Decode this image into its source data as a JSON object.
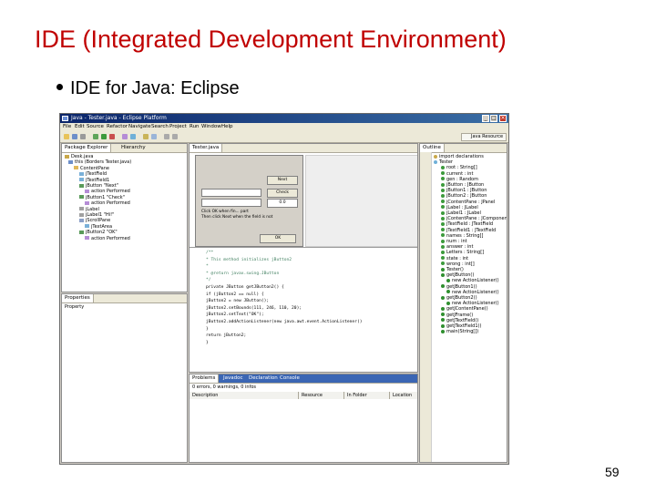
{
  "slide": {
    "title": "IDE (Integrated Development Environment)",
    "bullet": "IDE for Java: Eclipse",
    "page_number": "59"
  },
  "window": {
    "title": "Java - Tester.java - Eclipse Platform",
    "controls": [
      "_",
      "□",
      "×"
    ]
  },
  "menu": [
    "File",
    "Edit",
    "Source",
    "Refactor",
    "Navigate",
    "Search",
    "Project",
    "Run",
    "Window",
    "Help"
  ],
  "perspective": {
    "label": "Java",
    "other": "Resource"
  },
  "package_explorer": {
    "tabs": [
      "Package Explorer",
      "Hierarchy"
    ],
    "rows": [
      "Desk.java",
      "this (Borders Tester.java)",
      "ContentPane",
      "jTextField",
      "jTextField1",
      "jButton \"Next\"",
      "action Performed",
      "jButton1 \"Check\"",
      "action Performed",
      "jLabel",
      "jLabel1 \"Hi!\"",
      "jScrollPane",
      "jTextArea",
      "jButton2 \"OK\"",
      "action Performed"
    ]
  },
  "properties": {
    "tab": "Properties",
    "row": "Property"
  },
  "editor": {
    "tab": "Tester.java",
    "preview": {
      "btn1": "Next",
      "btn2": "Check",
      "field_value": "0.0",
      "text_line1": "Click OK when fin... part",
      "text_line2": "Then click Next when the field is not",
      "ok": "OK"
    },
    "code": [
      {
        "cls": "c-comment",
        "text": "/**"
      },
      {
        "cls": "c-comment",
        "text": " * This method initializes jButton2"
      },
      {
        "cls": "c-comment",
        "text": " *"
      },
      {
        "cls": "c-comment",
        "text": " * @return javax.swing.JButton"
      },
      {
        "cls": "c-comment",
        "text": " */"
      },
      {
        "cls": "",
        "text": "private JButton getJButton2() {"
      },
      {
        "cls": "",
        "text": "    if (jButton2 == null) {"
      },
      {
        "cls": "",
        "text": "        jButton2 = new JButton();"
      },
      {
        "cls": "",
        "text": "        jButton2.setBounds(111, 246, 110, 20);"
      },
      {
        "cls": "",
        "text": "        jButton2.setText(\"OK\");"
      },
      {
        "cls": "",
        "text": "        jButton2.addActionListener(new java.awt.event.ActionListener()"
      },
      {
        "cls": "",
        "text": "    }"
      },
      {
        "cls": "",
        "text": "    return jButton2;"
      },
      {
        "cls": "",
        "text": "}"
      }
    ]
  },
  "outline": {
    "tab": "Outline",
    "rows": [
      "import declarations",
      "Tester",
      "root : String[]",
      "current : int",
      "gen : Random",
      "jButton : JButton",
      "jButton1 : JButton",
      "jButton2 : JButton",
      "jContentPane : JPanel",
      "jLabel : JLabel",
      "jLabel1 : JLabel",
      "jContentPane : JComponent",
      "jTextField : JTextField",
      "jTextField1 : JTextField",
      "names : String[]",
      "num : int",
      "answer : int",
      "Letters : String[]",
      "state : int",
      "wrong : int[]",
      "Tester()",
      "getJButton()",
      "new ActionListener()",
      "getJButton1()",
      "new ActionListener()",
      "getJButton2()",
      "new ActionListener()",
      "getJContentPane()",
      "getJFrame()",
      "getJTextField()",
      "getJTextField1()",
      "main(String[])"
    ]
  },
  "problems": {
    "tabs": [
      "Problems",
      "Javadoc",
      "Declaration",
      "Console"
    ],
    "summary": "0 errors, 0 warnings, 0 infos",
    "columns": [
      "Description",
      "Resource",
      "In Folder",
      "Location"
    ]
  }
}
